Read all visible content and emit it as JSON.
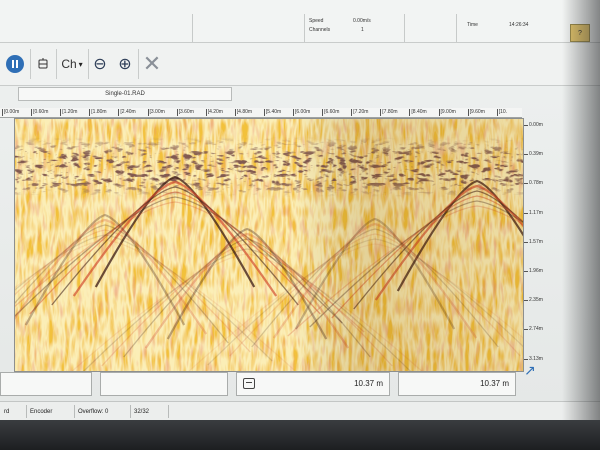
{
  "status": {
    "speed_label": "Speed",
    "speed_value": "0.00m/s",
    "channels_label": "Channels",
    "channels_value": "1",
    "time_label": "Time",
    "time_value": "14:26:34",
    "help_label": "?"
  },
  "toolbar": {
    "channel_label": "Ch",
    "channel_caret": "▾",
    "zoom_out_glyph": "⊖",
    "zoom_in_glyph": "⊕",
    "close_glyph": "✕"
  },
  "file": {
    "name": "Single-01.RAD"
  },
  "ruler": {
    "ticks": [
      "[0.00m",
      "[0.60m",
      "[1.20m",
      "[1.80m",
      "[2.40m",
      "[3.00m",
      "[3.60m",
      "[4.20m",
      "[4.80m",
      "[5.40m",
      "[6.00m",
      "[6.60m",
      "[7.20m",
      "[7.80m",
      "[8.40m",
      "[9.00m",
      "[9.60m",
      "[10."
    ]
  },
  "depth_axis": {
    "labels": [
      "0.00m",
      "0.39m",
      "0.78m",
      "1.17m",
      "1.57m",
      "1.96m",
      "2.35m",
      "2.74m",
      "3.13m"
    ]
  },
  "info": {
    "box3_value": "10.37 m",
    "box4_value": "10.37 m"
  },
  "bottom": {
    "cell1": "rd",
    "cell2": "Encoder",
    "cell3": "Overflow: 0",
    "cell4": "32/32"
  },
  "colors": {
    "radar_base": "#f2c13a",
    "radar_light": "#f7dc79",
    "radar_dark": "#3a1a14",
    "radar_red": "#d0442a",
    "accent_blue": "#2f6fb6"
  }
}
